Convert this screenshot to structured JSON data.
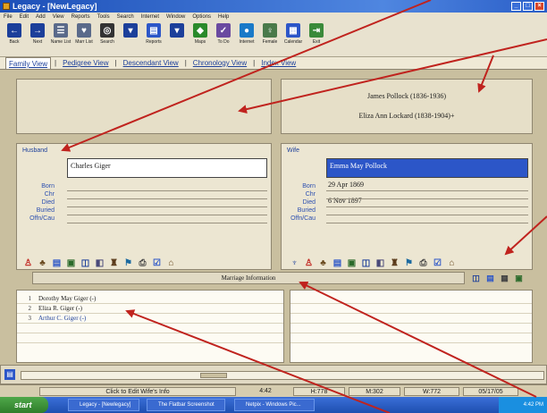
{
  "window": {
    "title": "Legacy - [NewLegacy]"
  },
  "menu": [
    "File",
    "Edit",
    "Add",
    "View",
    "Reports",
    "Tools",
    "Search",
    "Internet",
    "Window",
    "Options",
    "Help"
  ],
  "toolbar": [
    {
      "label": "Back",
      "icon": "back-arrow-icon",
      "color": "#1c3f9a"
    },
    {
      "label": "Next",
      "icon": "next-arrow-icon",
      "color": "#1c3f9a"
    },
    {
      "label": "Name List",
      "icon": "name-list-icon",
      "color": "#5a6a8a"
    },
    {
      "label": "Marr List",
      "icon": "marriage-list-icon",
      "color": "#5a6a8a"
    },
    {
      "label": "Search",
      "icon": "binoculars-icon",
      "color": "#333333"
    },
    {
      "label": "",
      "icon": "dropdown-icon",
      "color": "#1c3f9a"
    },
    {
      "label": "Reports",
      "icon": "reports-icon",
      "color": "#2c56c8"
    },
    {
      "label": "",
      "icon": "dropdown-icon",
      "color": "#1c3f9a"
    },
    {
      "label": "Maps",
      "icon": "maps-icon",
      "color": "#2a8a2a"
    },
    {
      "label": "To Do",
      "icon": "todo-icon",
      "color": "#6a4aa0"
    },
    {
      "label": "Internet",
      "icon": "globe-icon",
      "color": "#1a7ac8"
    },
    {
      "label": "Female",
      "icon": "female-icon",
      "color": "#4a7a4a"
    },
    {
      "label": "Calendar",
      "icon": "calendar-icon",
      "color": "#2c56c8"
    },
    {
      "label": "Exit",
      "icon": "exit-icon",
      "color": "#3a8a3a"
    }
  ],
  "view_tabs": [
    "Family View",
    "Pedigree View",
    "Descendant View",
    "Chronology View",
    "Index View"
  ],
  "active_tab": "Family View",
  "wife_parents": {
    "father": "James Pollock (1836-1936)",
    "mother": "Eliza Ann Lockard (1838-1904)+"
  },
  "husband": {
    "label": "Husband",
    "name": "Charles Giger",
    "fields": [
      "Born",
      "Chr",
      "Died",
      "Buried",
      "Offn/Cau"
    ],
    "values": [
      "",
      "",
      "",
      "",
      ""
    ]
  },
  "wife": {
    "label": "Wife",
    "name": "Emma May Pollock",
    "fields": [
      "Born",
      "Chr",
      "Died",
      "Buried",
      "Offn/Cau"
    ],
    "values": [
      "29 Apr 1869",
      "",
      "6 Nov 1897",
      "",
      ""
    ]
  },
  "marriage_info_label": "Marriage Information",
  "children": [
    {
      "num": "1",
      "name": "Dorothy May Giger (-)",
      "linked": false
    },
    {
      "num": "2",
      "name": "Eliza R. Giger (-)",
      "linked": false
    },
    {
      "num": "3",
      "name": "Arthur C. Giger (-)",
      "linked": true
    }
  ],
  "status": {
    "message": "Click to Edit Wife's Info",
    "time": "4:42",
    "h_field": "H:778",
    "m_field": "M:302",
    "w_field": "W:772",
    "date": "05/17/05"
  },
  "taskbar": {
    "start": "start",
    "items": [
      "Legacy - [Newlegacy]",
      "The Flatbar Screenshot",
      "Netpix - Windows Pic..."
    ],
    "clock": "4:42 PM"
  },
  "colors": {
    "title_bar": "#2b5fc8",
    "selected_name": "#2c56c8",
    "link_text": "#1c3f9a",
    "arrow": "#c0231e"
  }
}
